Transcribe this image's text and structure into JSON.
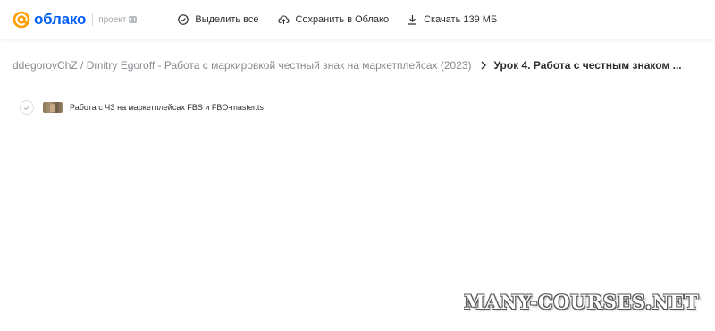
{
  "header": {
    "logo_text": "облако",
    "project_label": "проект",
    "actions": [
      {
        "label": "Выделить все",
        "icon": "check-circle-icon"
      },
      {
        "label": "Сохранить в Облако",
        "icon": "cloud-upload-icon"
      },
      {
        "label": "Скачать 139 МБ",
        "icon": "download-icon"
      }
    ]
  },
  "breadcrumb": {
    "parent": "ddegorovChZ / Dmitry Egoroff - Работа с маркировкой честный знак на маркетплейсах (2023)",
    "current": "Урок 4. Работа с честным знаком ..."
  },
  "files": [
    {
      "name": "Работа с ЧЗ на маркетплейсах FBS и FBO-master.ts"
    }
  ],
  "watermark": {
    "text": "MANY-COURSES.NET"
  },
  "colors": {
    "brand": "#005ff9",
    "brand_accent": "#ff9e00",
    "text": "#2c2d2e",
    "muted": "#87898f"
  }
}
